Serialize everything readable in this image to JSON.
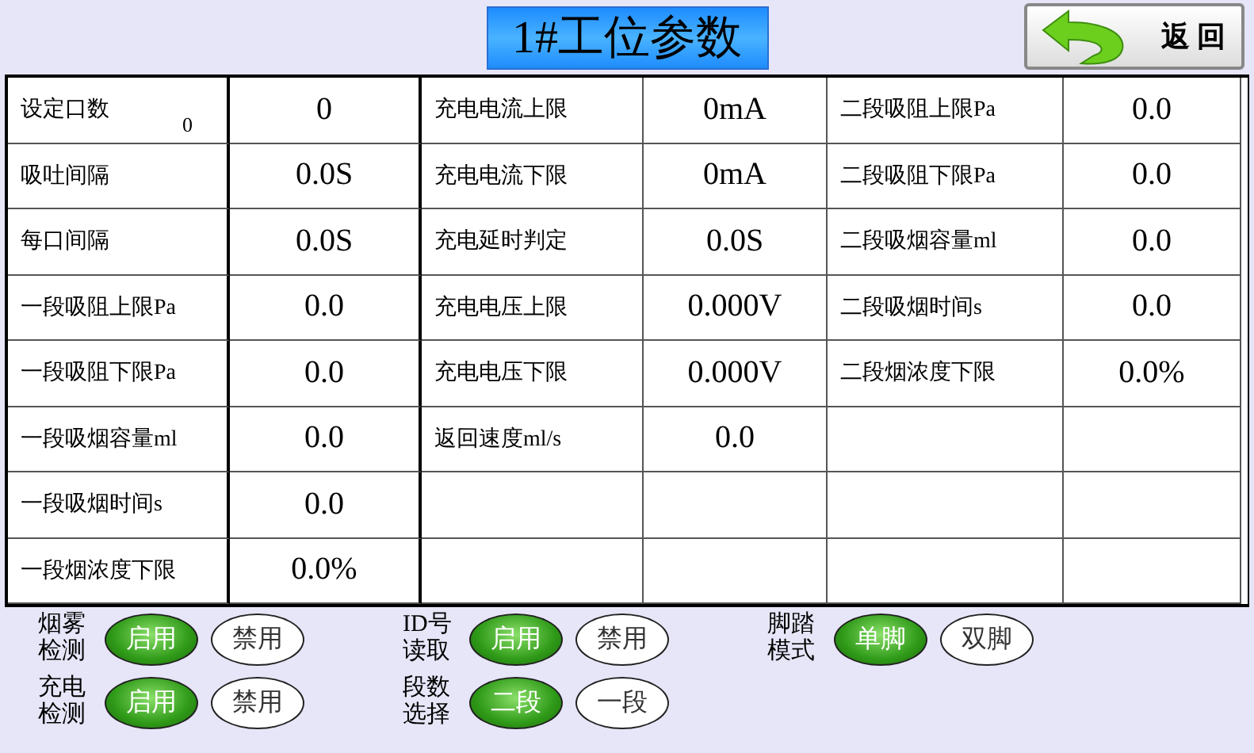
{
  "title": "1#工位参数",
  "back_button": {
    "label": "返 回"
  },
  "table": {
    "rows": [
      {
        "cells": [
          {
            "label": "设定口数",
            "note": "0",
            "value": "0"
          },
          {
            "label": "充电电流上限",
            "value": "0mA"
          },
          {
            "label": "二段吸阻上限Pa",
            "value": "0.0"
          }
        ]
      },
      {
        "cells": [
          {
            "label": "吸吐间隔",
            "value": "0.0S"
          },
          {
            "label": "充电电流下限",
            "value": "0mA"
          },
          {
            "label": "二段吸阻下限Pa",
            "value": "0.0"
          }
        ]
      },
      {
        "cells": [
          {
            "label": "每口间隔",
            "value": "0.0S"
          },
          {
            "label": "充电延时判定",
            "value": "0.0S"
          },
          {
            "label": "二段吸烟容量ml",
            "value": "0.0"
          }
        ]
      },
      {
        "cells": [
          {
            "label": "一段吸阻上限Pa",
            "value": "0.0"
          },
          {
            "label": "充电电压上限",
            "value": "0.000V"
          },
          {
            "label": "二段吸烟时间s",
            "value": "0.0"
          }
        ]
      },
      {
        "cells": [
          {
            "label": "一段吸阻下限Pa",
            "value": "0.0"
          },
          {
            "label": "充电电压下限",
            "value": "0.000V"
          },
          {
            "label": "二段烟浓度下限",
            "value": "0.0%"
          }
        ]
      },
      {
        "cells": [
          {
            "label": "一段吸烟容量ml",
            "value": "0.0"
          },
          {
            "label": "返回速度ml/s",
            "value": "0.0"
          }
        ]
      },
      {
        "cells": [
          {
            "label": "一段吸烟时间s",
            "value": "0.0"
          }
        ]
      },
      {
        "cells": [
          {
            "label": "一段烟浓度下限",
            "value": "0.0%"
          }
        ]
      }
    ]
  },
  "toggles": [
    {
      "label": [
        "烟雾",
        "检测"
      ],
      "options": [
        {
          "label": "启用",
          "selected": true
        },
        {
          "label": "禁用",
          "selected": false
        }
      ]
    },
    {
      "label": [
        "ID号",
        "读取"
      ],
      "options": [
        {
          "label": "启用",
          "selected": true
        },
        {
          "label": "禁用",
          "selected": false
        }
      ]
    },
    {
      "label": [
        "脚踏",
        "模式"
      ],
      "options": [
        {
          "label": "单脚",
          "selected": true
        },
        {
          "label": "双脚",
          "selected": false
        }
      ]
    },
    {
      "label": [
        "充电",
        "检测"
      ],
      "options": [
        {
          "label": "启用",
          "selected": true
        },
        {
          "label": "禁用",
          "selected": false
        }
      ]
    },
    {
      "label": [
        "段数",
        "选择"
      ],
      "options": [
        {
          "label": "二段",
          "selected": true
        },
        {
          "label": "一段",
          "selected": false
        }
      ]
    }
  ]
}
